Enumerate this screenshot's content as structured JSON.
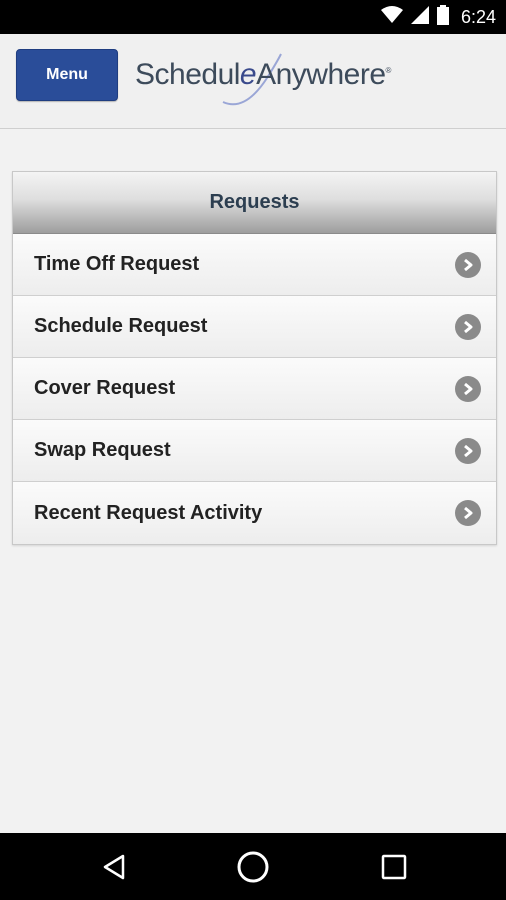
{
  "status_bar": {
    "time": "6:24",
    "icons": [
      "wifi-icon",
      "signal-icon",
      "battery-icon"
    ]
  },
  "header": {
    "menu_label": "Menu",
    "logo": {
      "part1": "Schedul",
      "part2": "e",
      "part3": "Anywhere",
      "mark": "®"
    }
  },
  "requests": {
    "title": "Requests",
    "items": [
      {
        "label": "Time Off Request"
      },
      {
        "label": "Schedule Request"
      },
      {
        "label": "Cover Request"
      },
      {
        "label": "Swap Request"
      },
      {
        "label": "Recent Request Activity"
      }
    ]
  },
  "nav_bar": {
    "buttons": [
      "back-icon",
      "home-icon",
      "recents-icon"
    ]
  },
  "colors": {
    "menu_button": "#2a4d99",
    "header_text": "#2c3e50",
    "chevron": "#8a8a8a"
  }
}
